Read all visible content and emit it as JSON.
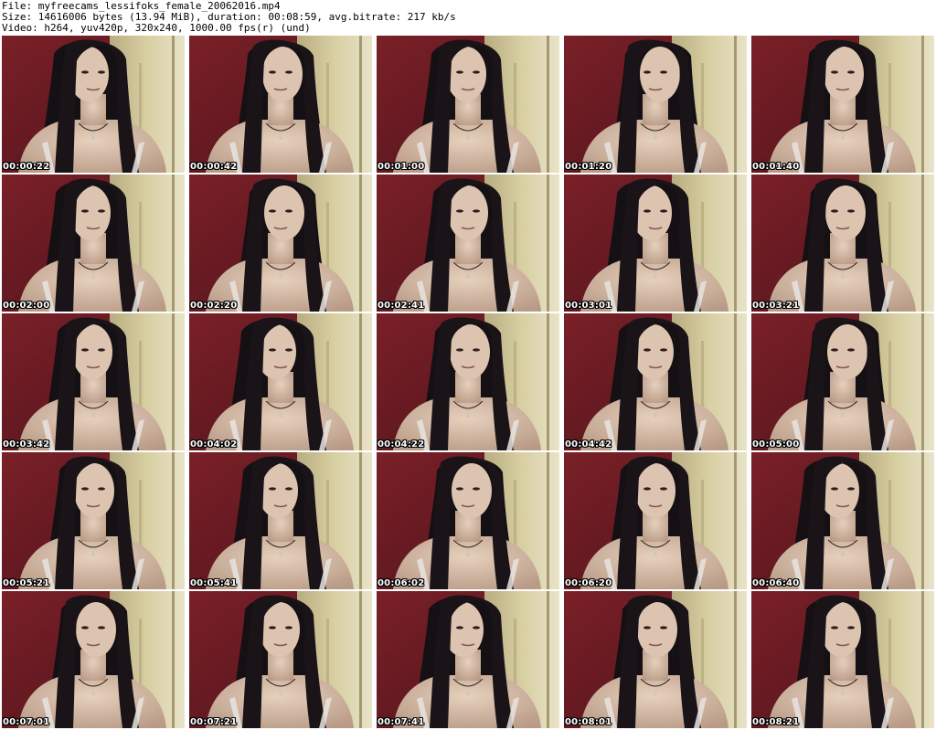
{
  "header": {
    "file_line": "File: myfreecams_lessifoks_female_20062016.mp4",
    "size_line": "Size: 14616006 bytes (13.94 MiB), duration: 00:08:59, avg.bitrate: 217 kb/s",
    "video_line": "Video: h264, yuv420p, 320x240, 1000.00 fps(r) (und)"
  },
  "colors": {
    "wall": "#6a1a22",
    "door": "#c9bd8e",
    "hair": "#141013",
    "skin": "#d8bfa8"
  },
  "thumbnails": [
    {
      "timestamp": "00:00:22"
    },
    {
      "timestamp": "00:00:42"
    },
    {
      "timestamp": "00:01:00"
    },
    {
      "timestamp": "00:01:20"
    },
    {
      "timestamp": "00:01:40"
    },
    {
      "timestamp": "00:02:00"
    },
    {
      "timestamp": "00:02:20"
    },
    {
      "timestamp": "00:02:41"
    },
    {
      "timestamp": "00:03:01"
    },
    {
      "timestamp": "00:03:21"
    },
    {
      "timestamp": "00:03:42"
    },
    {
      "timestamp": "00:04:02"
    },
    {
      "timestamp": "00:04:22"
    },
    {
      "timestamp": "00:04:42"
    },
    {
      "timestamp": "00:05:00"
    },
    {
      "timestamp": "00:05:21"
    },
    {
      "timestamp": "00:05:41"
    },
    {
      "timestamp": "00:06:02"
    },
    {
      "timestamp": "00:06:20"
    },
    {
      "timestamp": "00:06:40"
    },
    {
      "timestamp": "00:07:01"
    },
    {
      "timestamp": "00:07:21"
    },
    {
      "timestamp": "00:07:41"
    },
    {
      "timestamp": "00:08:01"
    },
    {
      "timestamp": "00:08:21"
    }
  ]
}
